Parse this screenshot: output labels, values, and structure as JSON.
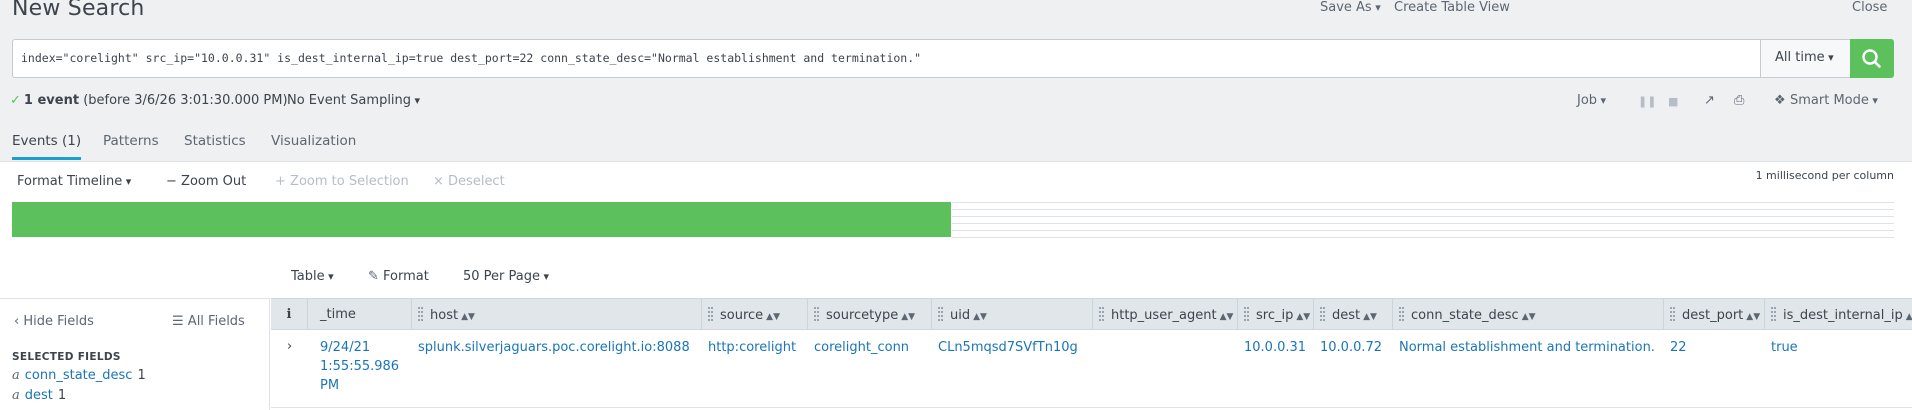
{
  "header": {
    "title": "New Search",
    "save_as": "Save As",
    "create_table_view": "Create Table View",
    "close": "Close"
  },
  "search": {
    "query": "index=\"corelight\" src_ip=\"10.0.0.31\" is_dest_internal_ip=true dest_port=22 conn_state_desc=\"Normal establishment and termination.\"",
    "time_range": "All time"
  },
  "status": {
    "event_count": "1 event",
    "before": "(before 3/6/26 3:01:30.000 PM)",
    "sampling": "No Event Sampling",
    "job": "Job",
    "mode": "Smart Mode"
  },
  "tabs": [
    {
      "label": "Events (1)"
    },
    {
      "label": "Patterns"
    },
    {
      "label": "Statistics"
    },
    {
      "label": "Visualization"
    }
  ],
  "timeline": {
    "format": "Format Timeline",
    "zoom_out": "Zoom Out",
    "zoom_to_selection": "Zoom to Selection",
    "deselect": "Deselect",
    "scale": "1 millisecond per column",
    "bar_fill_fraction": 0.499
  },
  "results_toolbar": {
    "view": "Table",
    "format": "Format",
    "per_page": "50 Per Page"
  },
  "sidebar": {
    "hide_fields": "Hide Fields",
    "all_fields": "All Fields",
    "selected_header": "SELECTED FIELDS",
    "fields": [
      {
        "type": "a",
        "name": "conn_state_desc",
        "count": "1"
      },
      {
        "type": "a",
        "name": "dest",
        "count": "1"
      }
    ]
  },
  "table": {
    "info_col": "i",
    "columns": [
      "_time",
      "host",
      "source",
      "sourcetype",
      "uid",
      "http_user_agent",
      "src_ip",
      "dest",
      "conn_state_desc",
      "dest_port",
      "is_dest_internal_ip"
    ],
    "row": {
      "time": "9/24/21 1:55:55.986 PM",
      "host": "splunk.silverjaguars.poc.corelight.io:8088",
      "source": "http:corelight",
      "sourcetype": "corelight_conn",
      "uid": "CLn5mqsd7SVfTn10g",
      "http_user_agent": "",
      "src_ip": "10.0.0.31",
      "dest": "10.0.0.72",
      "conn_state_desc": "Normal establishment and termination.",
      "dest_port": "22",
      "is_dest_internal_ip": "true"
    }
  },
  "colors": {
    "accent_green": "#5cc05c",
    "link_blue": "#1a75b8",
    "tab_underline": "#1a9fcf"
  }
}
